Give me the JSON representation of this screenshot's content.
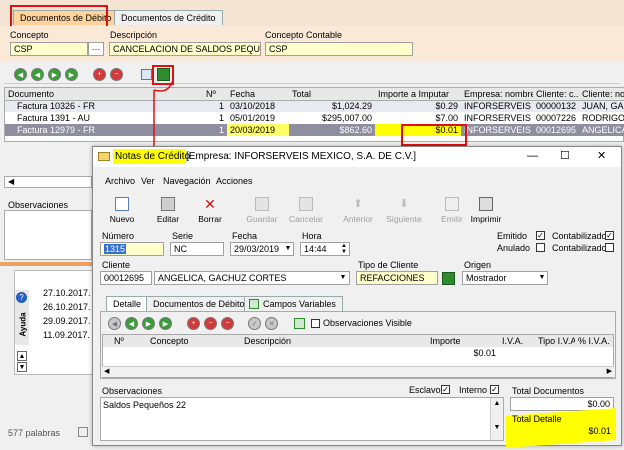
{
  "back": {
    "tabs": [
      "Documentos de Débito",
      "Documentos de Crédito"
    ],
    "labels": {
      "concepto": "Concepto",
      "descripcion": "Descripción",
      "concepto_contable": "Concepto Contable"
    },
    "values": {
      "concepto": "CSP",
      "ellipsis": "···",
      "descripcion": "CANCELACION DE SALDOS PEQUEÑ",
      "concepto_contable": "CSP"
    },
    "grid": {
      "columns": [
        "Documento",
        "Nº",
        "Fecha",
        "Total",
        "Importe a Imputar",
        "Empresa: nombre",
        "Cliente: c...",
        "Cliente: no"
      ],
      "rows": [
        [
          "Factura 10326 - FR",
          "1",
          "03/10/2018",
          "$1,024.29",
          "$0.29",
          "INFORSERVEIS ...",
          "00000132",
          "JUAN, GA"
        ],
        [
          "Factura 1391 - AU",
          "1",
          "05/01/2019",
          "$295,007.00",
          "$7.00",
          "INFORSERVEIS ...",
          "00007226",
          "RODRIGO"
        ],
        [
          "Factura 12979 - FR",
          "1",
          "20/03/2019",
          "$862.60",
          "$0.01",
          "INFORSERVEIS ...",
          "00012695",
          "ANGELICA"
        ]
      ]
    },
    "observaciones_label": "Observaciones",
    "side_dates": [
      "27.10.2017.",
      "26.10.2017.",
      "29.09.2017.",
      "11.09.2017."
    ],
    "side_tab": "Ayuda",
    "status": "577 palabras"
  },
  "dialog": {
    "title_prefix": "Notas de Crédito",
    "title_suffix": " [Empresa: INFORSERVEIS MEXICO, S.A. DE C.V.]",
    "min": "—",
    "max": "☐",
    "close": "✕",
    "menu": [
      "Archivo",
      "Ver",
      "Navegación",
      "Acciones"
    ],
    "toolbar": [
      "Nuevo",
      "Editar",
      "Borrar",
      "Guardar",
      "Cancelar",
      "Anterior",
      "Siguiente",
      "Emitir",
      "Imprimir"
    ],
    "labels": {
      "numero": "Número",
      "serie": "Serie",
      "fecha": "Fecha",
      "hora": "Hora",
      "cliente": "Cliente",
      "tipo_cliente": "Tipo de Cliente",
      "origen": "Origen"
    },
    "values": {
      "numero": "1315",
      "serie": "NC",
      "fecha": "29/03/2019",
      "hora": "14:44",
      "cliente_code": "00012695",
      "cliente_name": "ANGELICA, GACHUZ CORTES",
      "tipo_cliente": "REFACCIONES",
      "origen": "Mostrador"
    },
    "checks": {
      "emitido": "Emitido",
      "contabilizado": "Contabilizado",
      "anulado": "Anulado",
      "contabilizado2": "Contabilizado"
    },
    "tabs": [
      "Detalle",
      "Documentos de Débito",
      "Campos Variables"
    ],
    "observaciones_visible": "Observaciones Visible",
    "detail_columns": [
      "Nº",
      "Concepto",
      "Descripción",
      "Importe",
      "I.V.A.",
      "Tipo I.V.A.",
      "% I.V.A."
    ],
    "detail_row_importe": "$0.01",
    "observaciones_label": "Observaciones",
    "observaciones_text": "Saldos Pequeños 22",
    "esclavo": "Esclavo",
    "interno": "Interno",
    "total_documentos_label": "Total Documentos",
    "total_documentos": "$0.00",
    "total_detalle_label": "Total Detalle",
    "total_detalle": "$0.01"
  }
}
